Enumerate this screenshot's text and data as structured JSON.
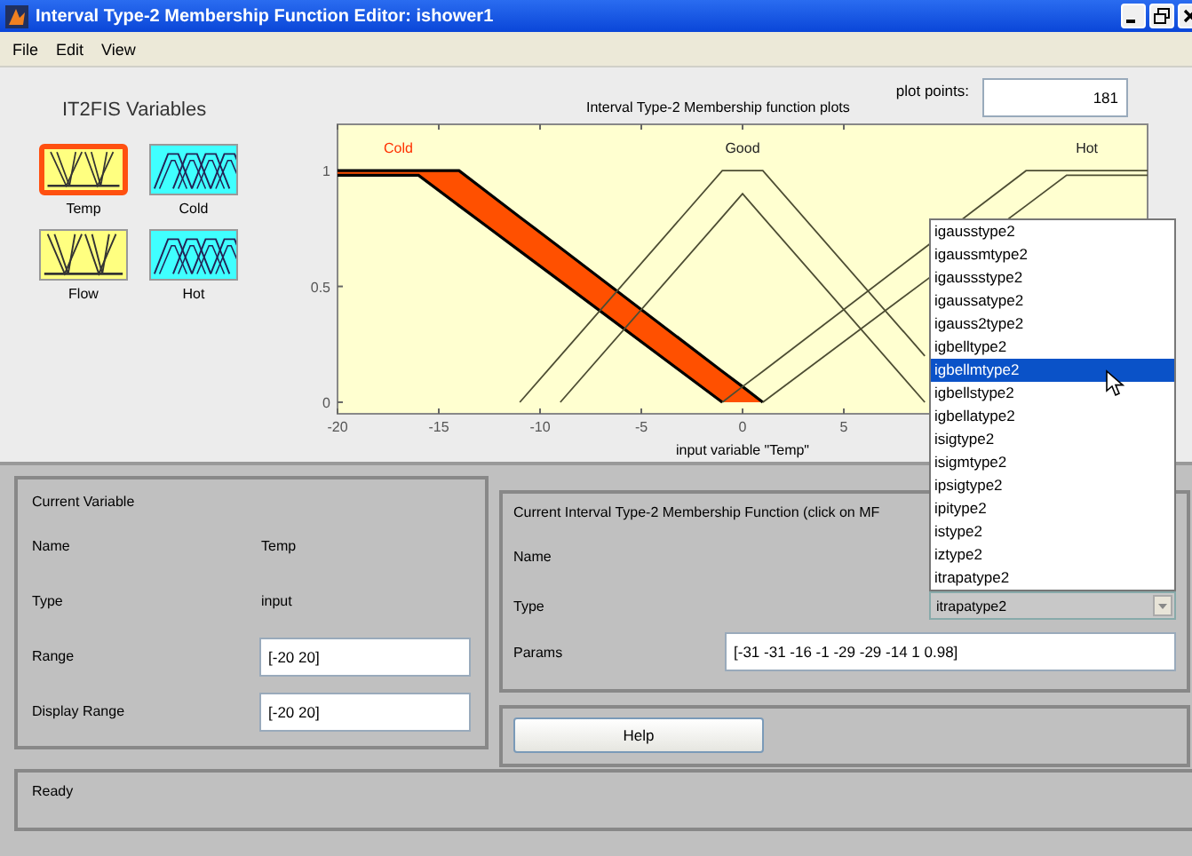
{
  "window": {
    "title": "Interval Type-2 Membership Function Editor: ishower1"
  },
  "menu": [
    "File",
    "Edit",
    "View"
  ],
  "variables": {
    "title": "IT2FIS Variables",
    "items": [
      {
        "name": "Temp",
        "kind": "input",
        "selected": true
      },
      {
        "name": "Cold",
        "kind": "output",
        "selected": false
      },
      {
        "name": "Flow",
        "kind": "input",
        "selected": false
      },
      {
        "name": "Hot",
        "kind": "output",
        "selected": false
      }
    ]
  },
  "plot": {
    "title": "Interval Type-2 Membership function plots",
    "plot_points_label": "plot points:",
    "plot_points": "181",
    "membership_functions": [
      {
        "label": "Cold",
        "selected": true
      },
      {
        "label": "Good",
        "selected": false
      },
      {
        "label": "Hot",
        "selected": false
      }
    ],
    "chart_data": {
      "type": "line",
      "xlabel": "input variable \"Temp\"",
      "xlim": [
        -20,
        20
      ],
      "ylim": [
        -0.05,
        1.2
      ],
      "xticks": [
        -20,
        -15,
        -10,
        -5,
        0,
        5
      ],
      "yticks": [
        0,
        0.5,
        1
      ],
      "x": [
        -20,
        -16,
        -14,
        -11,
        -9,
        -1,
        0,
        1,
        9,
        14,
        16,
        20
      ],
      "series": [
        {
          "color": "#000000",
          "values": [
            1,
            1,
            1,
            0.8,
            0.667,
            0.133,
            0.067,
            0,
            null,
            null,
            null,
            null
          ]
        },
        {
          "color": "#000000",
          "values": [
            0.98,
            0.98,
            0.849,
            0.653,
            0.523,
            0,
            null,
            null,
            null,
            null,
            null,
            null
          ]
        },
        {
          "color": "#4d4d33",
          "values": [
            null,
            null,
            null,
            0,
            0.2,
            1,
            1,
            1,
            0.2,
            null,
            null,
            null
          ]
        },
        {
          "color": "#4d4d33",
          "values": [
            null,
            null,
            null,
            null,
            0,
            0.8,
            0.9,
            0.8,
            0,
            null,
            null,
            null
          ]
        },
        {
          "color": "#4d4d33",
          "values": [
            null,
            null,
            null,
            null,
            null,
            0,
            0.067,
            0.133,
            0.667,
            1,
            1,
            1
          ]
        },
        {
          "color": "#4d4d33",
          "values": [
            null,
            null,
            null,
            null,
            null,
            null,
            null,
            0,
            0.523,
            0.849,
            0.98,
            0.98
          ]
        }
      ]
    }
  },
  "current_variable": {
    "title": "Current Variable",
    "fields": [
      {
        "label": "Name",
        "value": "Temp",
        "kind": "text"
      },
      {
        "label": "Type",
        "value": "input",
        "kind": "text"
      },
      {
        "label": "Range",
        "value": "[-20 20]",
        "kind": "input"
      },
      {
        "label": "Display Range",
        "value": "[-20 20]",
        "kind": "input"
      }
    ]
  },
  "current_mf": {
    "title": "Current Interval Type-2 Membership Function (click on MF",
    "name_label": "Name",
    "type_label": "Type",
    "type_value": "itrapatype2",
    "params_label": "Params",
    "params": "[-31 -31 -16 -1 -29 -29 -14 1 0.98]"
  },
  "type_options": [
    {
      "label": "igausstype2",
      "selected": false
    },
    {
      "label": "igaussmtype2",
      "selected": false
    },
    {
      "label": "igaussstype2",
      "selected": false
    },
    {
      "label": "igaussatype2",
      "selected": false
    },
    {
      "label": "igauss2type2",
      "selected": false
    },
    {
      "label": "igbelltype2",
      "selected": false
    },
    {
      "label": "igbellmtype2",
      "selected": true
    },
    {
      "label": "igbellstype2",
      "selected": false
    },
    {
      "label": "igbellatype2",
      "selected": false
    },
    {
      "label": "isigtype2",
      "selected": false
    },
    {
      "label": "isigmtype2",
      "selected": false
    },
    {
      "label": "ipsigtype2",
      "selected": false
    },
    {
      "label": "ipitype2",
      "selected": false
    },
    {
      "label": "istype2",
      "selected": false
    },
    {
      "label": "iztype2",
      "selected": false
    },
    {
      "label": "itrapatype2",
      "selected": false
    }
  ],
  "help_button": "Help",
  "status": "Ready"
}
